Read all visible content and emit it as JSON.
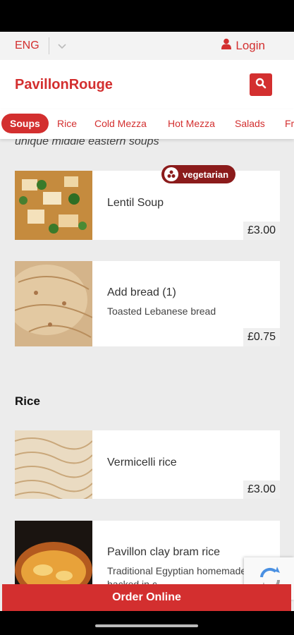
{
  "lang": {
    "label": "ENG"
  },
  "header": {
    "brand": "PavillonRouge",
    "login": "Login"
  },
  "categories": [
    {
      "label": "Soups"
    },
    {
      "label": "Rice"
    },
    {
      "label": "Cold Mezza"
    },
    {
      "label": "Hot Mezza"
    },
    {
      "label": "Salads"
    },
    {
      "label": "Fr"
    }
  ],
  "sections": [
    {
      "subtitle": "unique middle eastern soups",
      "items": [
        {
          "title": "Lentil Soup",
          "desc": "",
          "price": "£3.00",
          "badge": "vegetarian"
        },
        {
          "title": "Add bread (1)",
          "desc": "Toasted Lebanese bread",
          "price": "£0.75"
        }
      ]
    },
    {
      "title": "Rice",
      "items": [
        {
          "title": "Vermicelli rice",
          "price": "£3.00"
        },
        {
          "title": "Pavillon clay bram rice",
          "desc": "Traditional Egyptian homemade rice backed in c"
        }
      ]
    }
  ],
  "footer": {
    "order_label": "Order Online"
  },
  "colors": {
    "accent": "#d32f2f",
    "badge": "#8b1b1b",
    "background": "#ececec"
  }
}
